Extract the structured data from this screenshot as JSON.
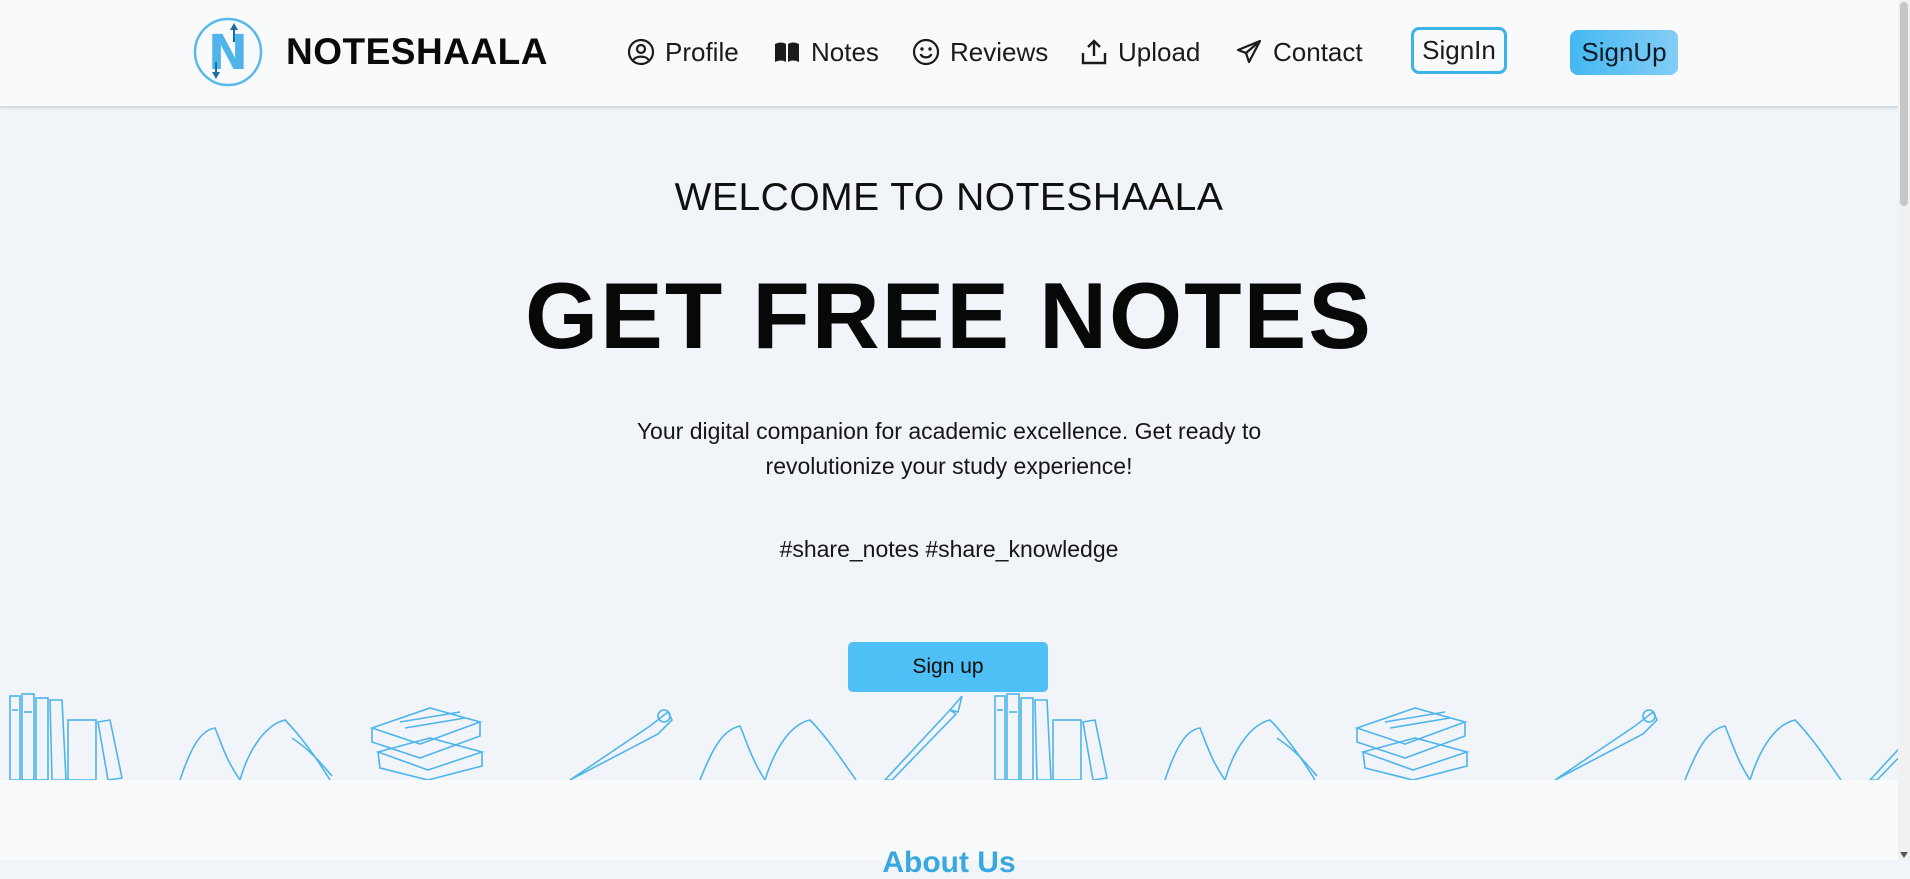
{
  "brand": {
    "name": "NOTESHAALA",
    "logo_letter": "N"
  },
  "nav": {
    "items": [
      {
        "label": "Profile",
        "icon": "user-circle-icon"
      },
      {
        "label": "Notes",
        "icon": "open-book-icon"
      },
      {
        "label": "Reviews",
        "icon": "smiley-icon"
      },
      {
        "label": "Upload",
        "icon": "upload-icon"
      },
      {
        "label": "Contact",
        "icon": "paper-plane-icon"
      }
    ],
    "signin_label": "SignIn",
    "signup_label": "SignUp"
  },
  "hero": {
    "welcome": "WELCOME TO NOTESHAALA",
    "headline": "GET FREE NOTES",
    "tagline": "Your digital companion for academic excellence. Get ready to revolutionize your study experience!",
    "hashtags": "#share_notes #share_knowledge",
    "cta_label": "Sign up"
  },
  "about": {
    "heading": "About Us"
  },
  "colors": {
    "accent": "#4fc0f5",
    "accent_dark": "#3bb2e8",
    "background": "#f1f5f9",
    "header_bg": "#f8fafc"
  }
}
